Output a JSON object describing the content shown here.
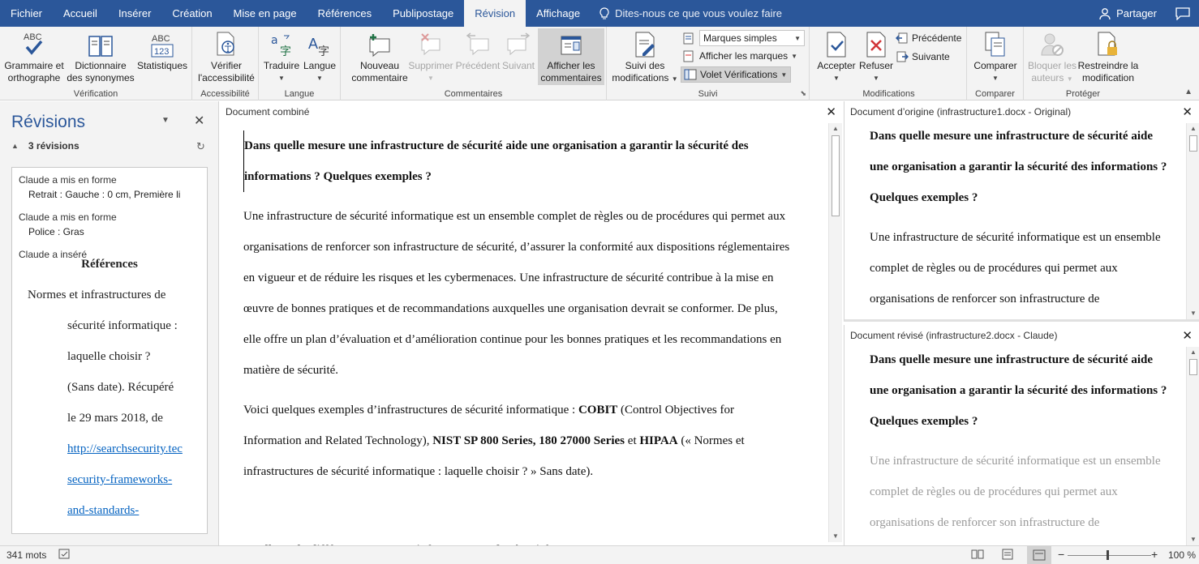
{
  "tabs": [
    "Fichier",
    "Accueil",
    "Insérer",
    "Création",
    "Mise en page",
    "Références",
    "Publipostage",
    "Révision",
    "Affichage"
  ],
  "tell_me": "Dites-nous ce que vous voulez faire",
  "share": "Partager",
  "ribbon": {
    "grammar": [
      "Grammaire et",
      "orthographe"
    ],
    "thesaurus": [
      "Dictionnaire",
      "des synonymes"
    ],
    "stats": "Statistiques",
    "verif_group": "Vérification",
    "access_btn": [
      "Vérifier",
      "l'accessibilité"
    ],
    "access_group": "Accessibilité",
    "translate": "Traduire",
    "language": "Langue",
    "language_group": "Langue",
    "new_comment": [
      "Nouveau",
      "commentaire"
    ],
    "delete": "Supprimer",
    "previous": "Précédent",
    "next": "Suivant",
    "show_comments": [
      "Afficher les",
      "commentaires"
    ],
    "comments_group": "Commentaires",
    "track": [
      "Suivi des",
      "modifications"
    ],
    "markup_select": "Marques simples",
    "show_markup": "Afficher les marques",
    "review_pane": "Volet Vérifications",
    "track_group": "Suivi",
    "accept": "Accepter",
    "reject": "Refuser",
    "prev_change": "Précédente",
    "next_change": "Suivante",
    "changes_group": "Modifications",
    "compare": "Comparer",
    "compare_group": "Comparer",
    "block_authors": [
      "Bloquer les",
      "auteurs"
    ],
    "restrict": [
      "Restreindre la",
      "modification"
    ],
    "protect_group": "Protéger"
  },
  "revisions": {
    "title": "Révisions",
    "count": "3 révisions",
    "items": [
      {
        "author": "Claude a mis en forme",
        "detail": "Retrait : Gauche : 0 cm, Première li"
      },
      {
        "author": "Claude a mis en forme",
        "detail": "Police : Gras"
      },
      {
        "author": "Claude a inséré",
        "detail": ""
      }
    ],
    "ref_title": "Références",
    "ref_lines": [
      "Normes et infrastructures de",
      "sécurité informatique :",
      "laquelle choisir ?",
      "(Sans date). Récupéré",
      "le 29 mars 2018, de"
    ],
    "ref_links": [
      "http://searchsecurity.tec",
      "security-frameworks-",
      "and-standards-"
    ]
  },
  "combined": {
    "header": "Document combiné",
    "heading": "Dans quelle mesure une infrastructure de sécurité aide une organisation a garantir la sécurité des informations ? Quelques exemples ?",
    "para1": "Une infrastructure de sécurité informatique est un ensemble complet de règles ou de procédures qui permet aux organisations de renforcer son infrastructure de sécurité, d’assurer la conformité aux dispositions réglementaires en vigueur et de réduire les risques et les cybermenaces. Une infrastructure de sécurité contribue à la mise en œuvre de bonnes pratiques et de recommandations auxquelles une organisation devrait se conformer. De plus, elle offre un plan d’évaluation et d’amélioration continue pour les bonnes pratiques et les recommandations en matière de sécurité.",
    "p2_a": "Voici quelques exemples d’infrastructures de sécurité informatique : ",
    "p2_b": "COBIT",
    "p2_c": " (Control Objectives for Information and Related Technology), ",
    "p2_d": "NIST SP 800 Series, 180 27000 Series",
    "p2_e": " et ",
    "p2_f": "HIPAA",
    "p2_g": " (« Normes et infrastructures de sécurité informatique : laquelle choisir ? » Sans date).",
    "heading2": "Quelle est la différence entre une infrastructure de sécurité et une norme ?"
  },
  "original": {
    "header": "Document d’origine (infrastructure1.docx - Original)",
    "heading": "Dans quelle mesure une infrastructure de sécurité aide une organisation a garantir la sécurité des informations ? Quelques exemples ?",
    "para": "Une infrastructure de sécurité informatique est un ensemble complet de règles ou de procédures qui permet aux organisations de renforcer son infrastructure de"
  },
  "revised": {
    "header": "Document révisé (infrastructure2.docx - Claude)",
    "heading": "Dans quelle mesure une infrastructure de sécurité aide une organisation a garantir la sécurité des informations ? Quelques exemples ?",
    "para": "Une infrastructure de sécurité informatique est un ensemble complet de règles ou de procédures qui permet aux organisations de renforcer son infrastructure de"
  },
  "status": {
    "words": "341 mots",
    "zoom": "100 %"
  }
}
